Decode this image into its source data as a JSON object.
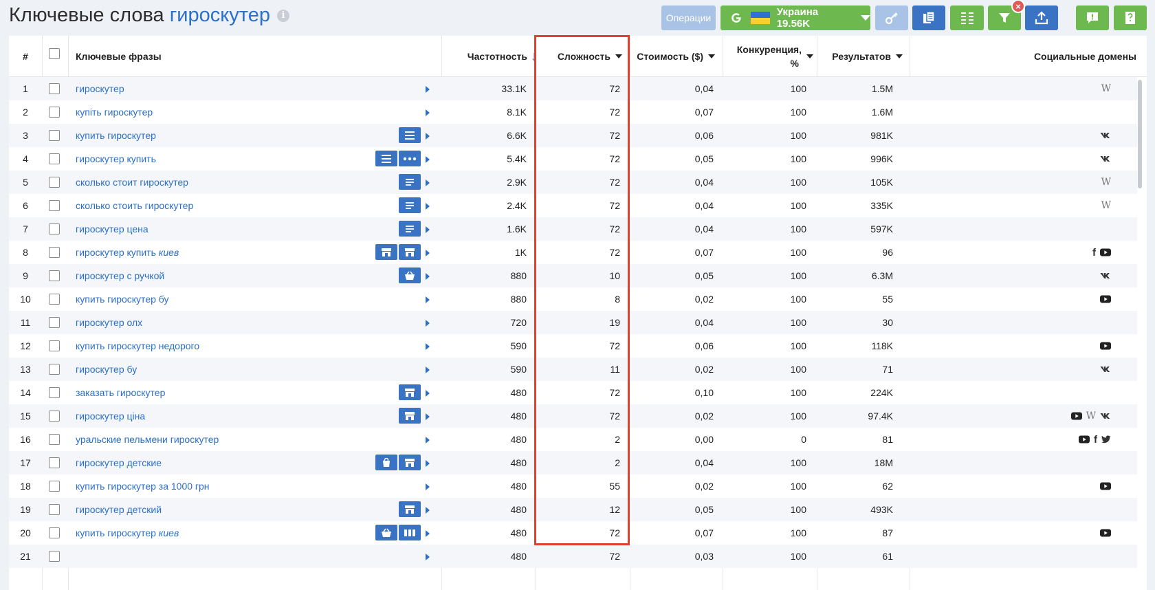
{
  "header": {
    "title": "Ключевые слова",
    "keyword": "гироскутер",
    "info_icon": "info-icon"
  },
  "toolbar": {
    "operations_label": "Операции",
    "country_label": "Украина 19.56K",
    "search_engine_icon": "google-icon",
    "flag_icon": "ukraine-flag-icon",
    "key_icon": "key-icon",
    "copy_icon": "copy-icon",
    "columns_icon": "columns-icon",
    "filter_icon": "filter-icon",
    "export_icon": "export-icon",
    "alert_icon": "alert-icon",
    "help_icon": "help-icon",
    "clear_filter_label": "×",
    "colors": {
      "green": "#6db84f",
      "blue": "#3a72c4",
      "light_blue": "#a8c3e6",
      "red": "#e05a5a"
    }
  },
  "table": {
    "columns": {
      "num": "#",
      "phrase": "Ключевые фразы",
      "frequency": "Частотность",
      "difficulty": "Сложность",
      "cost": "Стоимость ($)",
      "competition_line1": "Конкуренция,",
      "competition_line2": "%",
      "results": "Результатов",
      "social": "Социальные домены"
    },
    "sort_icon": "sort-down-arrow-icon",
    "highlight_color": "#e0412f",
    "rows": [
      {
        "n": "1",
        "phrase": "гироскутер",
        "italic": "",
        "features": [],
        "freq": "33.1K",
        "diff": "72",
        "cost": "0,04",
        "comp": "100",
        "res": "1.5M",
        "social": [
          "wikipedia"
        ]
      },
      {
        "n": "2",
        "phrase": "купіть гироскутер",
        "italic": "",
        "features": [],
        "freq": "8.1K",
        "diff": "72",
        "cost": "0,07",
        "comp": "100",
        "res": "1.6M",
        "social": []
      },
      {
        "n": "3",
        "phrase": "купить гироскутер",
        "italic": "",
        "features": [
          "list"
        ],
        "freq": "6.6K",
        "diff": "72",
        "cost": "0,06",
        "comp": "100",
        "res": "981K",
        "social": [
          "vk"
        ]
      },
      {
        "n": "4",
        "phrase": "гироскутер купить",
        "italic": "",
        "features": [
          "list",
          "more"
        ],
        "freq": "5.4K",
        "diff": "72",
        "cost": "0,05",
        "comp": "100",
        "res": "996K",
        "social": [
          "vk"
        ]
      },
      {
        "n": "5",
        "phrase": "сколько стоит гироскутер",
        "italic": "",
        "features": [
          "snippet"
        ],
        "freq": "2.9K",
        "diff": "72",
        "cost": "0,04",
        "comp": "100",
        "res": "105K",
        "social": [
          "wikipedia"
        ]
      },
      {
        "n": "6",
        "phrase": "сколько стоить гироскутер",
        "italic": "",
        "features": [
          "snippet"
        ],
        "freq": "2.4K",
        "diff": "72",
        "cost": "0,04",
        "comp": "100",
        "res": "335K",
        "social": [
          "wikipedia"
        ]
      },
      {
        "n": "7",
        "phrase": "гироскутер цена",
        "italic": "",
        "features": [
          "snippet"
        ],
        "freq": "1.6K",
        "diff": "72",
        "cost": "0,04",
        "comp": "100",
        "res": "597K",
        "social": []
      },
      {
        "n": "8",
        "phrase": "гироскутер купить",
        "italic": "киев",
        "features": [
          "store",
          "store"
        ],
        "freq": "1K",
        "diff": "72",
        "cost": "0,07",
        "comp": "100",
        "res": "96",
        "social": [
          "facebook",
          "youtube"
        ]
      },
      {
        "n": "9",
        "phrase": "гироскутер с ручкой",
        "italic": "",
        "features": [
          "basket"
        ],
        "freq": "880",
        "diff": "10",
        "cost": "0,05",
        "comp": "100",
        "res": "6.3M",
        "social": [
          "vk"
        ]
      },
      {
        "n": "10",
        "phrase": "купить гироскутер бу",
        "italic": "",
        "features": [],
        "freq": "880",
        "diff": "8",
        "cost": "0,02",
        "comp": "100",
        "res": "55",
        "social": [
          "youtube"
        ]
      },
      {
        "n": "11",
        "phrase": "гироскутер олх",
        "italic": "",
        "features": [],
        "freq": "720",
        "diff": "19",
        "cost": "0,04",
        "comp": "100",
        "res": "30",
        "social": []
      },
      {
        "n": "12",
        "phrase": "купить гироскутер недорого",
        "italic": "",
        "features": [],
        "freq": "590",
        "diff": "72",
        "cost": "0,06",
        "comp": "100",
        "res": "118K",
        "social": [
          "youtube"
        ]
      },
      {
        "n": "13",
        "phrase": "гироскутер бу",
        "italic": "",
        "features": [],
        "freq": "590",
        "diff": "11",
        "cost": "0,02",
        "comp": "100",
        "res": "71",
        "social": [
          "vk"
        ]
      },
      {
        "n": "14",
        "phrase": "заказать гироскутер",
        "italic": "",
        "features": [
          "store"
        ],
        "freq": "480",
        "diff": "72",
        "cost": "0,10",
        "comp": "100",
        "res": "224K",
        "social": []
      },
      {
        "n": "15",
        "phrase": "гироскутер ціна",
        "italic": "",
        "features": [
          "store"
        ],
        "freq": "480",
        "diff": "72",
        "cost": "0,02",
        "comp": "100",
        "res": "97.4K",
        "social": [
          "youtube",
          "wikipedia",
          "vk"
        ]
      },
      {
        "n": "16",
        "phrase": "уральские пельмени гироскутер",
        "italic": "",
        "features": [],
        "freq": "480",
        "diff": "2",
        "cost": "0,00",
        "comp": "0",
        "res": "81",
        "social": [
          "youtube",
          "facebook",
          "twitter"
        ]
      },
      {
        "n": "17",
        "phrase": "гироскутер детские",
        "italic": "",
        "features": [
          "bag",
          "store"
        ],
        "freq": "480",
        "diff": "2",
        "cost": "0,04",
        "comp": "100",
        "res": "18M",
        "social": []
      },
      {
        "n": "18",
        "phrase": "купить гироскутер за 1000 грн",
        "italic": "",
        "features": [],
        "freq": "480",
        "diff": "55",
        "cost": "0,02",
        "comp": "100",
        "res": "62",
        "social": [
          "youtube"
        ]
      },
      {
        "n": "19",
        "phrase": "гироскутер детский",
        "italic": "",
        "features": [
          "store"
        ],
        "freq": "480",
        "diff": "12",
        "cost": "0,05",
        "comp": "100",
        "res": "493K",
        "social": []
      },
      {
        "n": "20",
        "phrase": "купить гироскутер",
        "italic": "киев",
        "features": [
          "basket",
          "carousel"
        ],
        "freq": "480",
        "diff": "72",
        "cost": "0,07",
        "comp": "100",
        "res": "87",
        "social": [
          "youtube"
        ]
      },
      {
        "n": "21",
        "phrase": "",
        "italic": "",
        "features": [],
        "freq": "480",
        "diff": "72",
        "cost": "0,03",
        "comp": "100",
        "res": "61",
        "social": []
      }
    ]
  }
}
